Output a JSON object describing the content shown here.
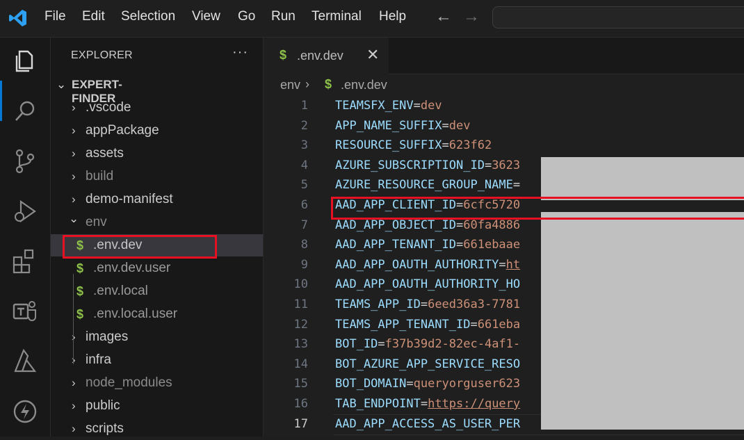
{
  "menu": [
    "File",
    "Edit",
    "Selection",
    "View",
    "Go",
    "Run",
    "Terminal",
    "Help"
  ],
  "nav": {
    "back": "←",
    "forward": "→"
  },
  "explorer": {
    "title": "EXPLORER",
    "more": "···",
    "root": "EXPERT-FINDER",
    "items": [
      {
        "label": ".vscode",
        "chevron": "›",
        "dim": false
      },
      {
        "label": "appPackage",
        "chevron": "›",
        "dim": false
      },
      {
        "label": "assets",
        "chevron": "›",
        "dim": false
      },
      {
        "label": "build",
        "chevron": "›",
        "dim": true
      },
      {
        "label": "demo-manifest",
        "chevron": "›",
        "dim": false
      },
      {
        "label": "env",
        "chevron": "⌄",
        "dim": true
      },
      {
        "label": ".env.dev",
        "file": true,
        "selected": true
      },
      {
        "label": ".env.dev.user",
        "file": true
      },
      {
        "label": ".env.local",
        "file": true
      },
      {
        "label": ".env.local.user",
        "file": true
      },
      {
        "label": "images",
        "chevron": "›",
        "dim": false
      },
      {
        "label": "infra",
        "chevron": "›",
        "dim": false
      },
      {
        "label": "node_modules",
        "chevron": "›",
        "dim": true
      },
      {
        "label": "public",
        "chevron": "›",
        "dim": false
      },
      {
        "label": "scripts",
        "chevron": "›",
        "dim": false
      }
    ]
  },
  "tab": {
    "label": ".env.dev",
    "close": "✕"
  },
  "breadcrumb": {
    "folder": "env",
    "sep": "›",
    "file": ".env.dev",
    "dollar": "$"
  },
  "file_icon": "$",
  "code_lines": [
    {
      "n": "1",
      "key": "TEAMSFX_ENV",
      "val": "dev"
    },
    {
      "n": "2",
      "key": "APP_NAME_SUFFIX",
      "val": "dev"
    },
    {
      "n": "3",
      "key": "RESOURCE_SUFFIX",
      "val": "623f62"
    },
    {
      "n": "4",
      "key": "AZURE_SUBSCRIPTION_ID",
      "val": "3623"
    },
    {
      "n": "5",
      "key": "AZURE_RESOURCE_GROUP_NAME",
      "val": ""
    },
    {
      "n": "6",
      "key": "AAD_APP_CLIENT_ID",
      "val": "6cfc5720"
    },
    {
      "n": "7",
      "key": "AAD_APP_OBJECT_ID",
      "val": "60fa4886"
    },
    {
      "n": "8",
      "key": "AAD_APP_TENANT_ID",
      "val": "661ebaae"
    },
    {
      "n": "9",
      "key": "AAD_APP_OAUTH_AUTHORITY",
      "val": "ht",
      "link": true
    },
    {
      "n": "10",
      "key": "AAD_APP_OAUTH_AUTHORITY_HO",
      "val": "",
      "noeq": true
    },
    {
      "n": "11",
      "key": "TEAMS_APP_ID",
      "val": "6eed36a3-7781"
    },
    {
      "n": "12",
      "key": "TEAMS_APP_TENANT_ID",
      "val": "661eba"
    },
    {
      "n": "13",
      "key": "BOT_ID",
      "val": "f37b39d2-82ec-4af1-"
    },
    {
      "n": "14",
      "key": "BOT_AZURE_APP_SERVICE_RESO",
      "val": "",
      "noeq": true
    },
    {
      "n": "15",
      "key": "BOT_DOMAIN",
      "val": "queryorguser623"
    },
    {
      "n": "16",
      "key": "TAB_ENDPOINT",
      "val": "https://query",
      "link": true
    },
    {
      "n": "17",
      "key": "AAD_APP_ACCESS_AS_USER_PER",
      "val": "",
      "noeq": true,
      "current": true
    }
  ],
  "colors": {
    "accent": "#0078d4",
    "highlight_box": "#e81123",
    "key": "#9cdcfe",
    "value": "#ce9178",
    "env_icon": "#8dc149"
  },
  "activity_icons": [
    "explorer-icon",
    "search-icon",
    "source-control-icon",
    "run-debug-icon",
    "extensions-icon",
    "teams-toolkit-icon",
    "azure-icon",
    "thunder-icon"
  ]
}
